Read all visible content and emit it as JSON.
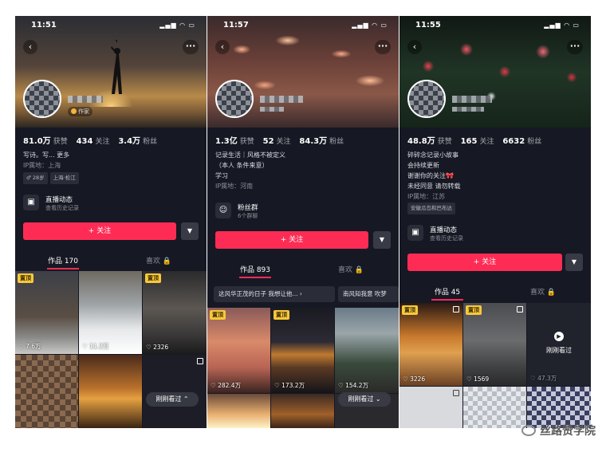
{
  "phones": [
    {
      "time": "11:51",
      "role_badge": "作家",
      "stats": [
        {
          "value": "81.0万",
          "label": "获赞"
        },
        {
          "value": "434",
          "label": "关注"
        },
        {
          "value": "3.4万",
          "label": "粉丝"
        }
      ],
      "bio": [
        "写诗。写... 更多",
        "IP属地：上海"
      ],
      "tags": [
        "♂ 28岁",
        "上海·松江"
      ],
      "feature": {
        "title": "直播动态",
        "subtitle": "查看历史记录"
      },
      "follow_label": "+ 关注",
      "tabs": [
        "作品 170",
        "喜欢 🔒"
      ],
      "videos": [
        {
          "pinned": "置顶",
          "likes": "♡ 7.6万"
        },
        {
          "pinned": "",
          "likes": "♡ 11.2万"
        },
        {
          "pinned": "置顶",
          "likes": "♡ 2326"
        }
      ],
      "just_seen": "刚刚看过 ⌃"
    },
    {
      "time": "11:57",
      "stats": [
        {
          "value": "1.3亿",
          "label": "获赞"
        },
        {
          "value": "52",
          "label": "关注"
        },
        {
          "value": "84.3万",
          "label": "粉丝"
        }
      ],
      "bio": [
        "记录生活｜风格不被定义",
        "（本人 条件来意）",
        "学习",
        "IP属地：河南"
      ],
      "feature": {
        "title": "粉丝群",
        "subtitle": "6个群聊"
      },
      "follow_label": "+ 关注",
      "tabs": [
        "作品 893",
        "喜欢 🔒"
      ],
      "chips": [
        "这风华正茂的日子 我想让他... ›",
        "南风知我意 吹梦"
      ],
      "videos": [
        {
          "pinned": "置顶",
          "likes": "♡ 282.4万"
        },
        {
          "pinned": "置顶",
          "likes": "♡ 173.2万"
        },
        {
          "pinned": "",
          "likes": "♡ 154.2万"
        }
      ],
      "just_seen": "刚刚看过 ⌄"
    },
    {
      "time": "11:55",
      "stats": [
        {
          "value": "48.8万",
          "label": "获赞"
        },
        {
          "value": "165",
          "label": "关注"
        },
        {
          "value": "6632",
          "label": "粉丝"
        }
      ],
      "bio": [
        "碎碎念记录小故事",
        "会持续更新",
        "谢谢你的关注🎀",
        "未经同意 请勿转载",
        "IP属地：江苏"
      ],
      "tags": [
        "安徽瓜岛和巴布达"
      ],
      "feature": {
        "title": "直播动态",
        "subtitle": "查看历史记录"
      },
      "follow_label": "+ 关注",
      "tabs": [
        "作品 45",
        "喜欢 🔒"
      ],
      "videos": [
        {
          "pinned": "置顶",
          "likes": "♡ 3226"
        },
        {
          "pinned": "置顶",
          "likes": "♡ 1569"
        },
        {
          "pinned": "",
          "likes": "♡ 47.3万"
        }
      ],
      "just_seen": "刚刚看过"
    }
  ],
  "watermark": "丝路赞学院",
  "colors": {
    "accent": "#fe2c55",
    "background": "#161823",
    "pin": "#f7c83b"
  }
}
